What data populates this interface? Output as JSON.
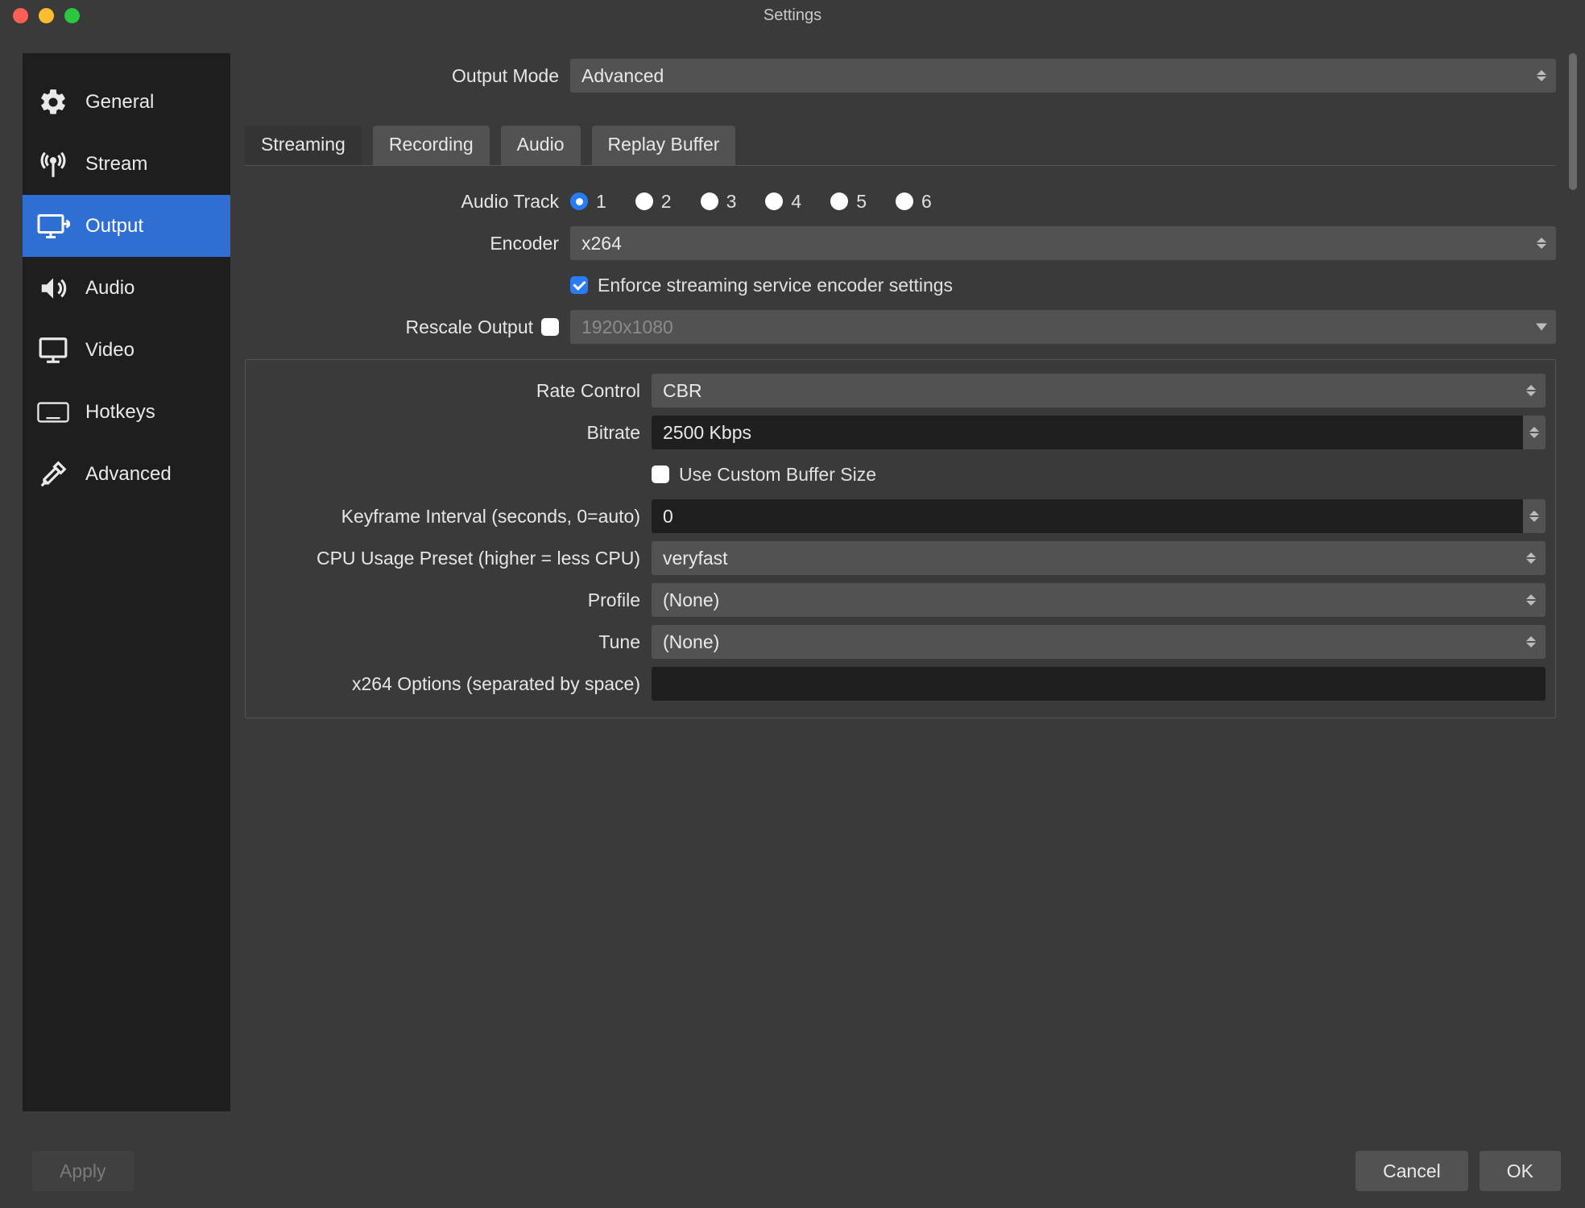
{
  "window": {
    "title": "Settings"
  },
  "sidebar": {
    "items": [
      {
        "label": "General"
      },
      {
        "label": "Stream"
      },
      {
        "label": "Output"
      },
      {
        "label": "Audio"
      },
      {
        "label": "Video"
      },
      {
        "label": "Hotkeys"
      },
      {
        "label": "Advanced"
      }
    ],
    "active_index": 2
  },
  "output_mode": {
    "label": "Output Mode",
    "value": "Advanced"
  },
  "tabs": {
    "items": [
      {
        "label": "Streaming"
      },
      {
        "label": "Recording"
      },
      {
        "label": "Audio"
      },
      {
        "label": "Replay Buffer"
      }
    ],
    "active_index": 0
  },
  "streaming": {
    "audio_track": {
      "label": "Audio Track",
      "options": [
        "1",
        "2",
        "3",
        "4",
        "5",
        "6"
      ],
      "selected": "1"
    },
    "encoder": {
      "label": "Encoder",
      "value": "x264"
    },
    "enforce": {
      "label": "Enforce streaming service encoder settings",
      "checked": true
    },
    "rescale": {
      "label": "Rescale Output",
      "checked": false,
      "value": "1920x1080"
    }
  },
  "encoder_settings": {
    "rate_control": {
      "label": "Rate Control",
      "value": "CBR"
    },
    "bitrate": {
      "label": "Bitrate",
      "value": "2500 Kbps"
    },
    "custom_buffer": {
      "label": "Use Custom Buffer Size",
      "checked": false
    },
    "keyframe": {
      "label": "Keyframe Interval (seconds, 0=auto)",
      "value": "0"
    },
    "cpu_preset": {
      "label": "CPU Usage Preset (higher = less CPU)",
      "value": "veryfast"
    },
    "profile": {
      "label": "Profile",
      "value": "(None)"
    },
    "tune": {
      "label": "Tune",
      "value": "(None)"
    },
    "x264_opts": {
      "label": "x264 Options (separated by space)",
      "value": ""
    }
  },
  "footer": {
    "apply": "Apply",
    "cancel": "Cancel",
    "ok": "OK"
  },
  "colors": {
    "accent": "#2f6fd4",
    "check_accent": "#2a7bf6"
  }
}
